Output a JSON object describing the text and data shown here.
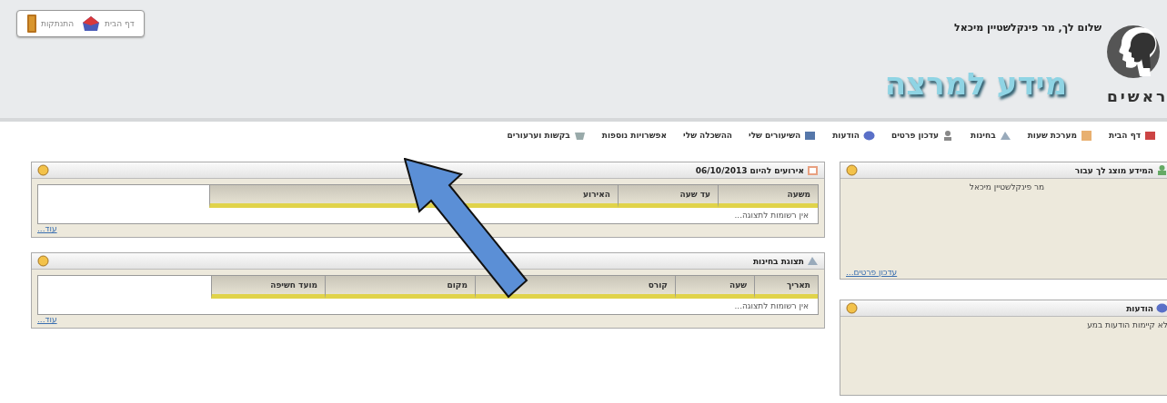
{
  "header": {
    "greeting": "שלום לך, מר פינקלשטיין מיכאל",
    "logo_text": "ראשים",
    "site_title": "מידע למרצה",
    "top_links": [
      {
        "label": "דף הבית",
        "kind": "home"
      },
      {
        "label": "התנתקות",
        "kind": "logout"
      }
    ]
  },
  "nav": [
    {
      "label": "דף הבית",
      "icon": true
    },
    {
      "label": "מערכת שעות",
      "icon": true
    },
    {
      "label": "בחינות",
      "icon": true
    },
    {
      "label": "עדכון פרטים",
      "icon": true
    },
    {
      "label": "הודעות",
      "icon": true
    },
    {
      "label": "השיעורים שלי",
      "icon": true
    },
    {
      "label": "ההשכלה שלי",
      "icon": false
    },
    {
      "label": "אפשרויות נוספות",
      "icon": false
    },
    {
      "label": "בקשות וערעורים",
      "icon": true
    }
  ],
  "main_panels": [
    {
      "title": "אירועים להיום 06/10/2013",
      "columns": [
        "משעה",
        "עד שעה",
        "האירוע"
      ],
      "empty_text": "אין רשומות לתצוגה...",
      "more_link": "עוד..."
    },
    {
      "title": "תצוגת בחינות",
      "columns": [
        "תאריך",
        "שעה",
        "קורס",
        "מקום",
        "מועד חשיפה"
      ],
      "empty_text": "אין רשומות לתצוגה...",
      "more_link": "עוד..."
    }
  ],
  "side_panels": [
    {
      "title": "המידע מוצג לך עבור",
      "body": "מר פינקלשטיין מיכאל",
      "link": "עדכון פרטים..."
    },
    {
      "title": "הודעות",
      "body": "לא קיימות הודעות במע"
    }
  ]
}
